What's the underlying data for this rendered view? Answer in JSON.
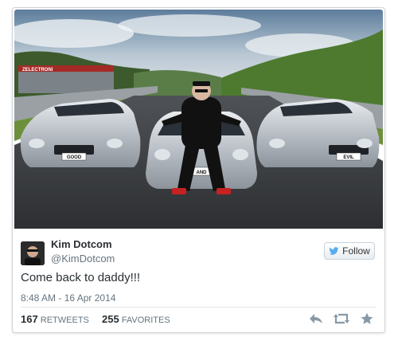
{
  "tweet": {
    "name": "Kim Dotcom",
    "handle": "@KimDotcom",
    "text": "Come back to daddy!!!",
    "timestamp": "8:48 AM - 16 Apr 2014",
    "follow_label": "Follow",
    "retweets_count": "167",
    "retweets_label": "RETWEETS",
    "favorites_count": "255",
    "favorites_label": "FAVORITES"
  },
  "photo": {
    "plates": [
      "GOOD",
      "AND",
      "EVIL"
    ],
    "track_sign": "ZELECTRONI"
  },
  "icons": {
    "follow": "bird-icon",
    "reply": "reply-icon",
    "retweet": "retweet-icon",
    "favorite": "star-icon"
  },
  "colors": {
    "twitter_blue": "#55acee",
    "text": "#292f33",
    "muted": "#66757f",
    "action_icon": "#8899a6"
  }
}
